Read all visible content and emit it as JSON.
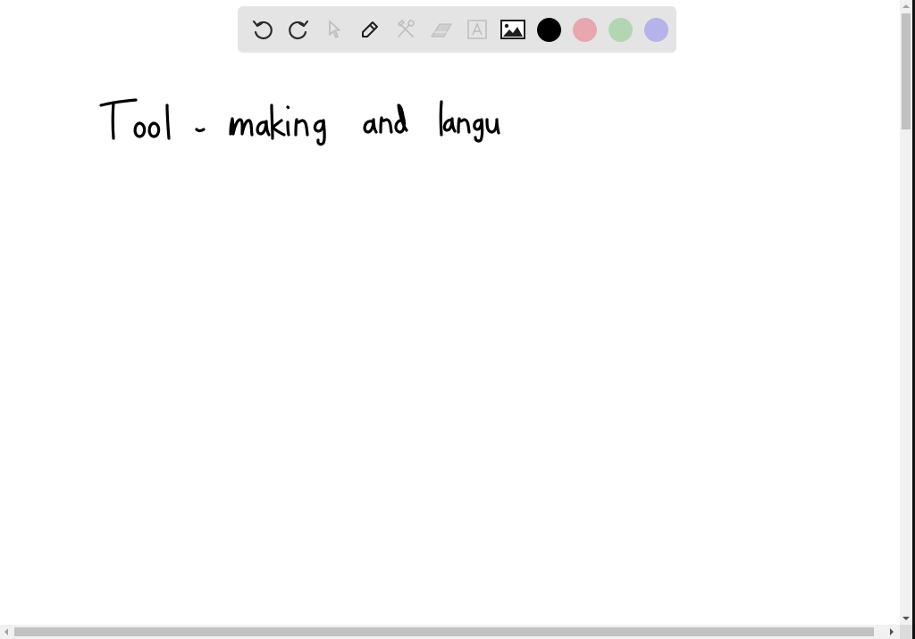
{
  "toolbar": {
    "tools": [
      {
        "name": "undo",
        "icon": "undo-icon",
        "enabled": true
      },
      {
        "name": "redo",
        "icon": "redo-icon",
        "enabled": true
      },
      {
        "name": "select",
        "icon": "cursor-arrow-icon",
        "enabled": false
      },
      {
        "name": "pen",
        "icon": "pencil-icon",
        "enabled": true,
        "active": true
      },
      {
        "name": "tools",
        "icon": "wrench-hammer-icon",
        "enabled": false
      },
      {
        "name": "eraser",
        "icon": "eraser-icon",
        "enabled": false
      },
      {
        "name": "text",
        "icon": "text-box-icon",
        "enabled": false
      },
      {
        "name": "image",
        "icon": "image-icon",
        "enabled": true
      }
    ],
    "colors": [
      {
        "name": "black",
        "hex": "#000000",
        "selected": true
      },
      {
        "name": "pink",
        "hex": "#e8a6af"
      },
      {
        "name": "green",
        "hex": "#b2d6b2"
      },
      {
        "name": "lavender",
        "hex": "#b5b3ea"
      }
    ]
  },
  "canvas": {
    "handwritten_text": "Tool - making and langu",
    "ink_color": "#000000"
  }
}
